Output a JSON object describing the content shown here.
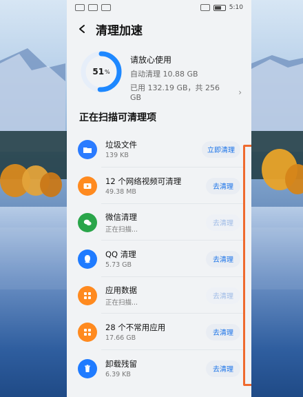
{
  "status_bar": {
    "time": "5:10"
  },
  "app": {
    "title": "清理加速"
  },
  "storage": {
    "percent_used": 51,
    "percent_text": "51",
    "percent_sign": "%",
    "headline": "请放心使用",
    "auto_clean": "自动清理 10.88 GB",
    "used_line": "已用 132.19 GB，共 256 GB"
  },
  "scan": {
    "section_title": "正在扫描可清理项",
    "items": [
      {
        "name": "垃圾文件",
        "meta": "139 KB",
        "action": "立即清理",
        "icon": "folder-icon",
        "color": "#2a7bff",
        "disabled": false
      },
      {
        "name": "12 个网络视频可清理",
        "meta": "49.38 MB",
        "action": "去清理",
        "icon": "video-icon",
        "color": "#ff8a1f",
        "disabled": false
      },
      {
        "name": "微信清理",
        "meta": "正在扫描...",
        "action": "去清理",
        "icon": "wechat-icon",
        "color": "#2aa54a",
        "disabled": true
      },
      {
        "name": "QQ 清理",
        "meta": "5.73 GB",
        "action": "去清理",
        "icon": "qq-icon",
        "color": "#1f7bff",
        "disabled": false
      },
      {
        "name": "应用数据",
        "meta": "正在扫描...",
        "action": "去清理",
        "icon": "grid-icon",
        "color": "#ff8a1f",
        "disabled": true
      },
      {
        "name": "28 个不常用应用",
        "meta": "17.66 GB",
        "action": "去清理",
        "icon": "grid-icon",
        "color": "#ff8a1f",
        "disabled": false
      },
      {
        "name": "卸载残留",
        "meta": "6.39 KB",
        "action": "去清理",
        "icon": "trash-icon",
        "color": "#1f7bff",
        "disabled": false
      }
    ]
  },
  "colors": {
    "accent": "#1a73e8",
    "highlight": "#ef6a2e",
    "ring": "#1e88ff",
    "ring_track": "#e6eef9"
  }
}
